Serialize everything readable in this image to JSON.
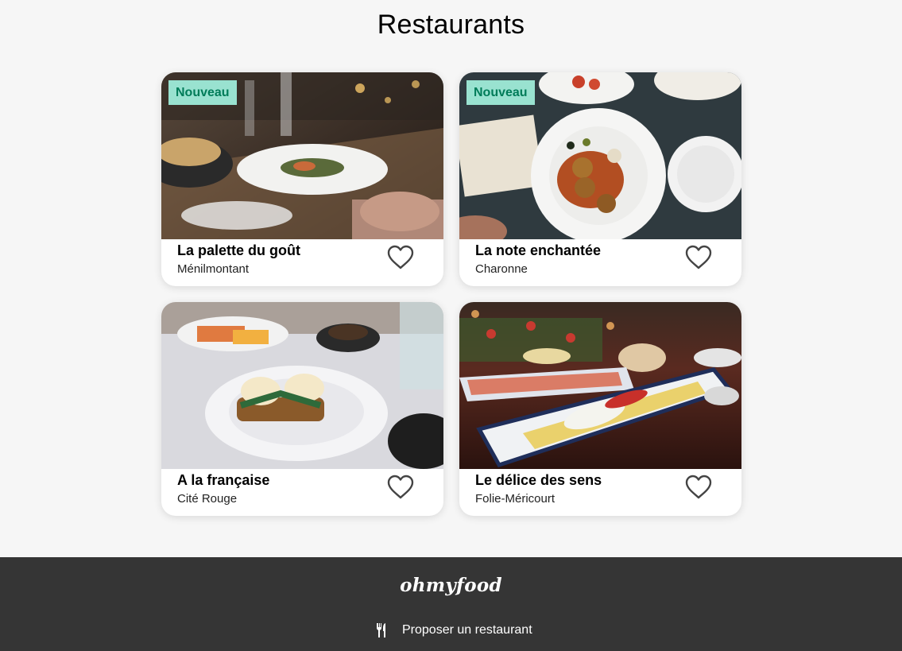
{
  "page": {
    "title": "Restaurants"
  },
  "badge_label": "Nouveau",
  "restaurants": [
    {
      "name": "La palette du goût",
      "location": "Ménilmontant",
      "is_new": true,
      "image_icon": "restaurant-table-photo"
    },
    {
      "name": "La note enchantée",
      "location": "Charonne",
      "is_new": true,
      "image_icon": "meatball-plate-photo"
    },
    {
      "name": "A la française",
      "location": "Cité Rouge",
      "is_new": false,
      "image_icon": "eggs-benedict-photo"
    },
    {
      "name": "Le délice des sens",
      "location": "Folie-Méricourt",
      "is_new": false,
      "image_icon": "fish-platter-photo"
    }
  ],
  "footer": {
    "logo": "ohmyfood",
    "links": [
      {
        "label": "Proposer un restaurant",
        "icon": "cutlery-icon"
      }
    ]
  },
  "colors": {
    "background": "#f6f6f6",
    "badge_bg": "#99e2d0",
    "badge_text": "#007c59",
    "footer_bg": "#353535"
  }
}
